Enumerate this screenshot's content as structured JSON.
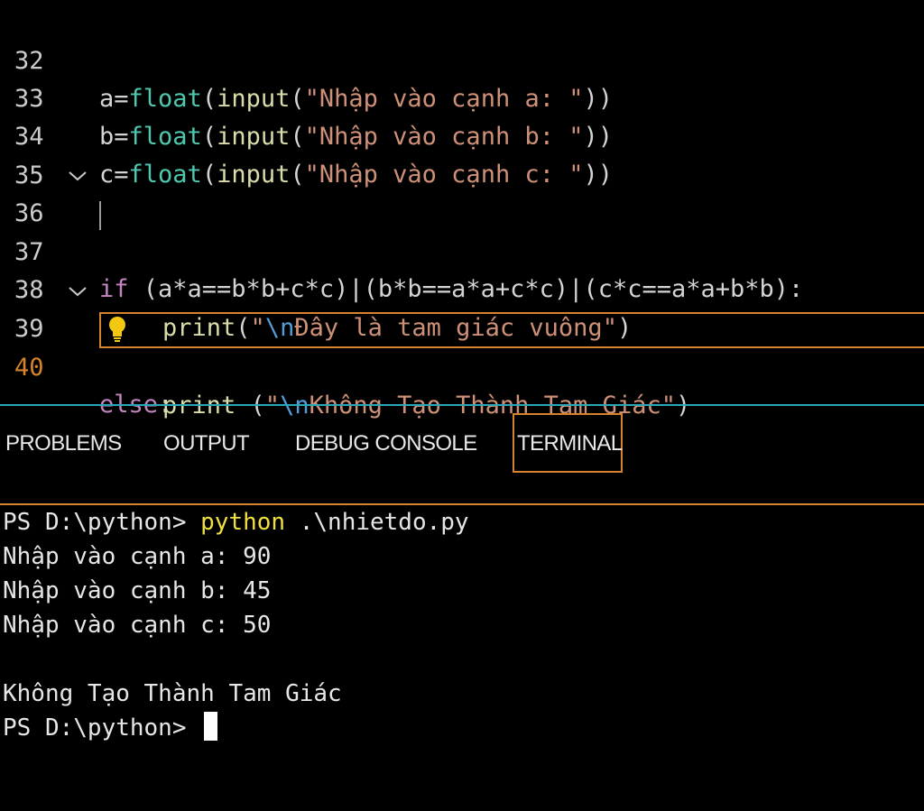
{
  "editor": {
    "lines": [
      {
        "num": "32",
        "var": "a",
        "eq": "=",
        "fn1": "float",
        "p1": "(",
        "fn2": "input",
        "p2": "(",
        "str": "\"Nhập vào cạnh a: \"",
        "close": "))"
      },
      {
        "num": "33",
        "var": "b",
        "eq": "=",
        "fn1": "float",
        "p1": "(",
        "fn2": "input",
        "p2": "(",
        "str": "\"Nhập vào cạnh b: \"",
        "close": "))"
      },
      {
        "num": "34",
        "var": "c",
        "eq": "=",
        "fn1": "float",
        "p1": "(",
        "fn2": "input",
        "p2": "(",
        "str": "\"Nhập vào cạnh c: \"",
        "close": "))"
      }
    ],
    "line35": {
      "num": "35"
    },
    "line36": {
      "num": "36",
      "kw": "if",
      "rest": " (a*a==b*b+c*c)|(b*b==a*a+c*c)|(c*c==a*a+b*b):"
    },
    "line37": {
      "num": "37",
      "fn": "print",
      "open": "(",
      "q1": "\"",
      "esc": "\\n",
      "text": "Đây là tam giác vuông\"",
      "close": ")"
    },
    "line38": {
      "num": "38"
    },
    "line39": {
      "num": "39",
      "kw": "else",
      "colon": ":"
    },
    "line40": {
      "num": "40",
      "fn": "print",
      "open": " (",
      "q1": "\"",
      "esc": "\\n",
      "text": "Không Tạo Thành Tam Giác\"",
      "close": ")"
    },
    "fold_icon": "chevron-down-icon",
    "lightbulb_icon": "lightbulb-icon",
    "colors": {
      "current_line_accent": "#d7822d",
      "panel_border": "#2aa7b8"
    }
  },
  "panel": {
    "tabs": [
      {
        "label": "PROBLEMS"
      },
      {
        "label": "OUTPUT"
      },
      {
        "label": "DEBUG CONSOLE"
      },
      {
        "label": "TERMINAL"
      }
    ],
    "active_tab": "TERMINAL"
  },
  "terminal": {
    "prompt1": "PS D:\\python> ",
    "cmd": "python",
    "args": " .\\nhietdo.py",
    "out1": "Nhập vào cạnh a: 90",
    "out2": "Nhập vào cạnh b: 45",
    "out3": "Nhập vào cạnh c: 50",
    "result": "Không Tạo Thành Tam Giác",
    "prompt2": "PS D:\\python> "
  }
}
